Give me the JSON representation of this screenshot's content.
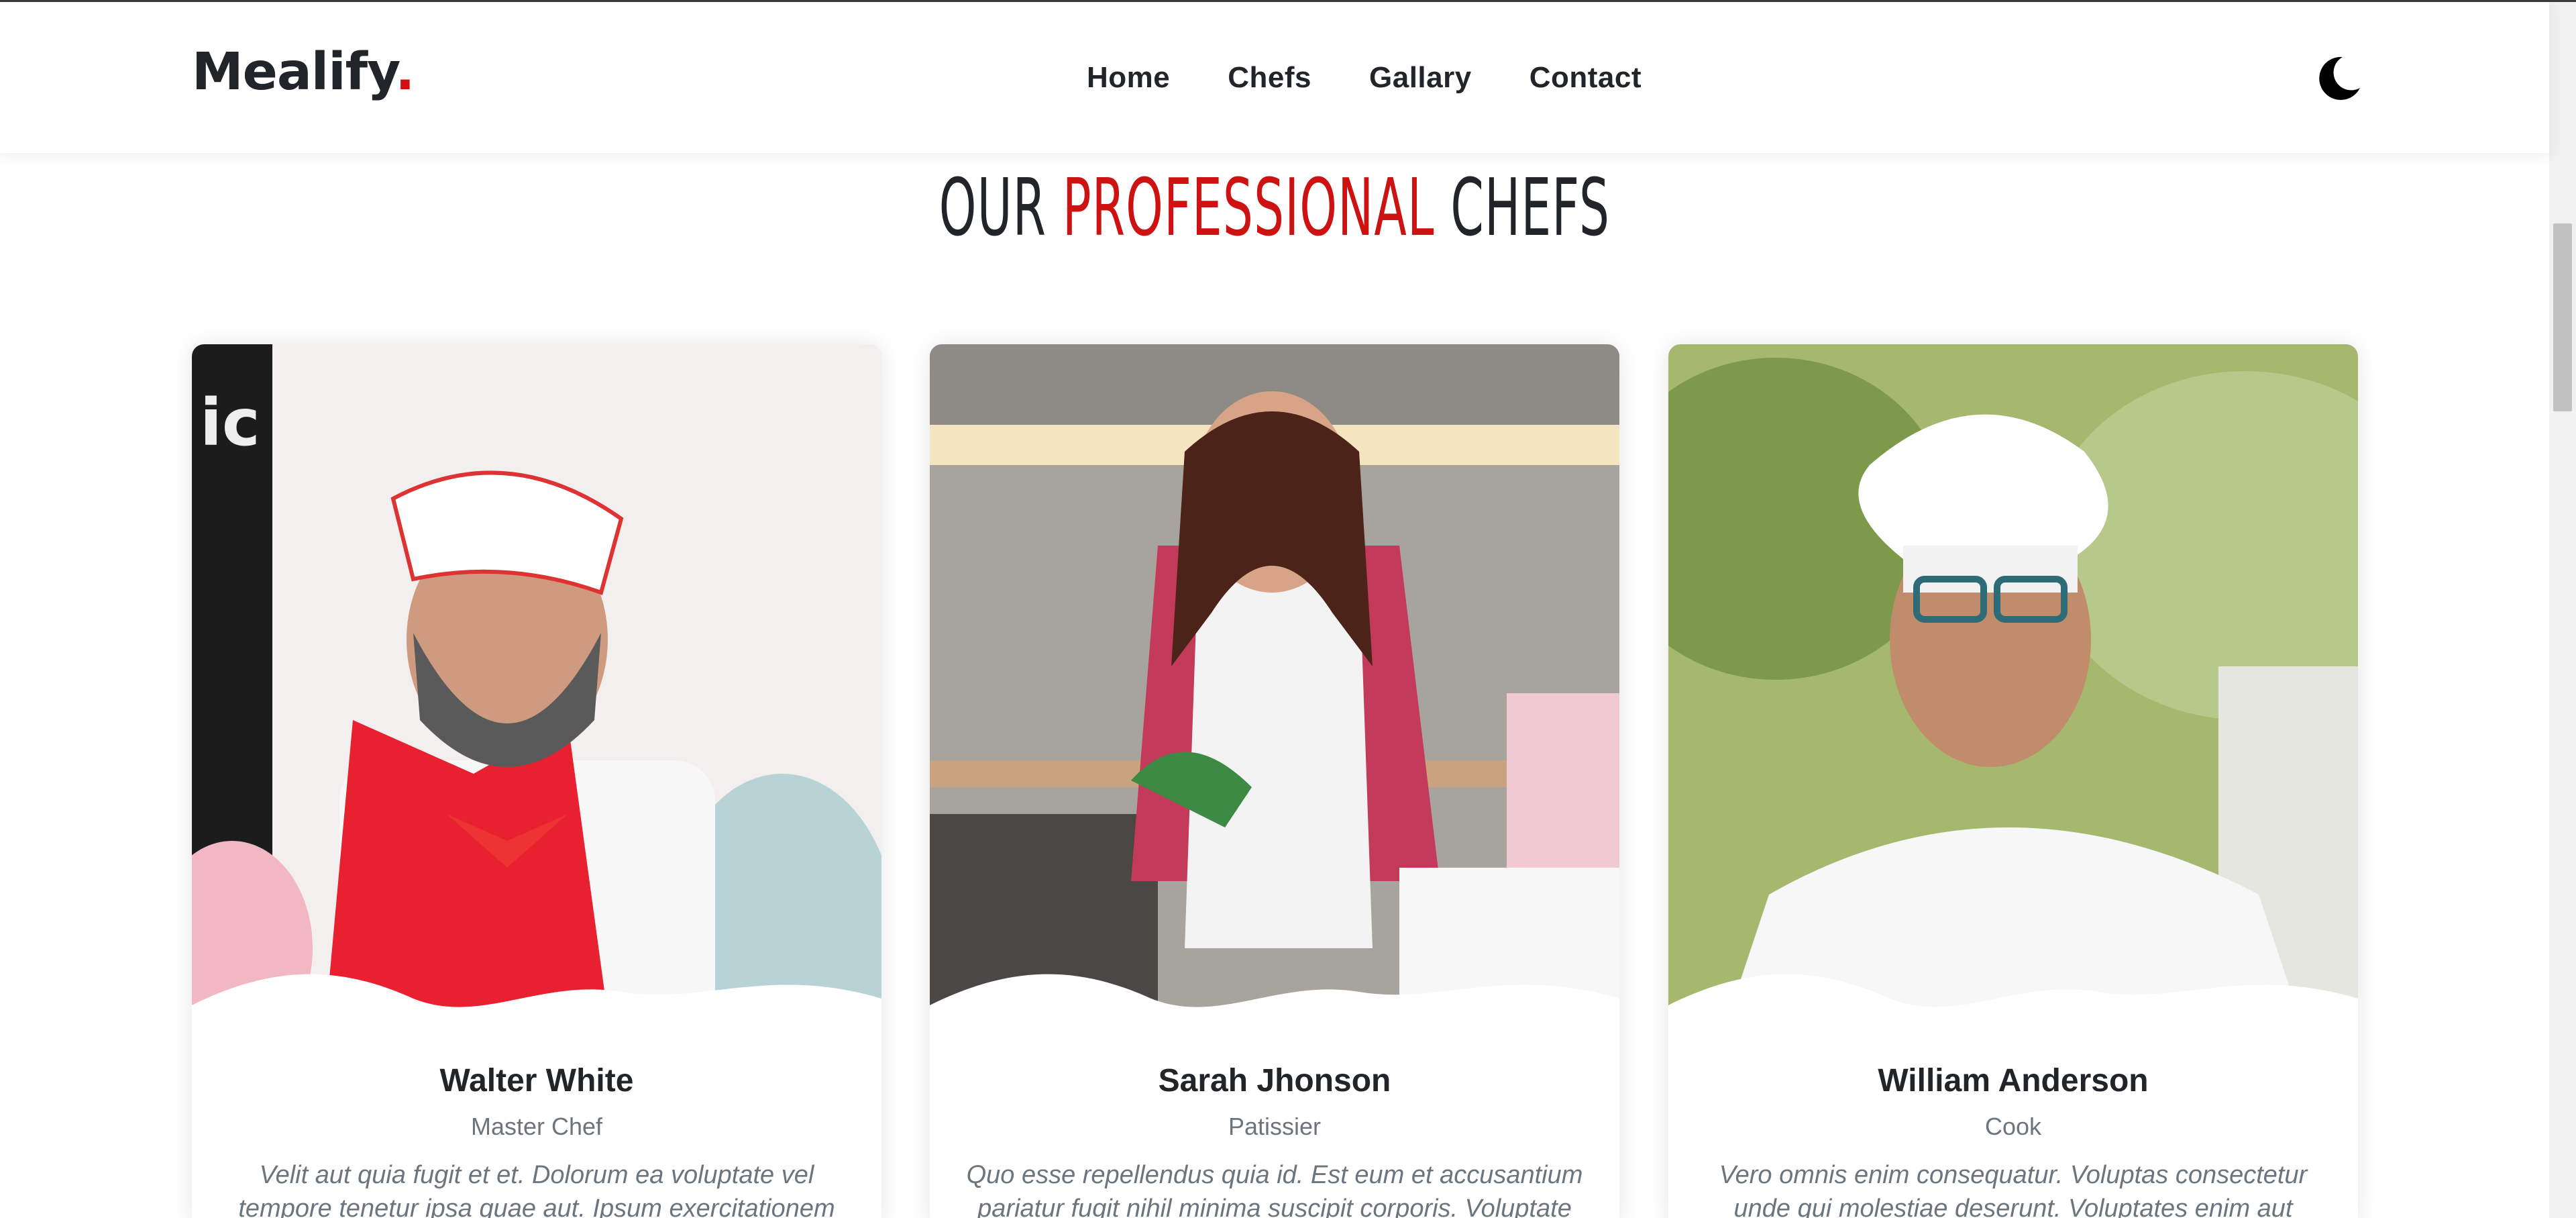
{
  "header": {
    "logo_text": "Mealify",
    "logo_dot": ".",
    "nav": [
      {
        "label": "Home"
      },
      {
        "label": "Chefs"
      },
      {
        "label": "Gallary"
      },
      {
        "label": "Contact"
      }
    ],
    "theme_toggle_icon": "moon-icon"
  },
  "section": {
    "title_part1": "OUR",
    "title_accent": "PROFESSIONAL",
    "title_part2": "CHEFS"
  },
  "chefs": [
    {
      "name": "Walter White",
      "role": "Master Chef",
      "bio": "Velit aut quia fugit et et. Dolorum ea voluptate vel tempore tenetur ipsa quae aut. Ipsum exercitationem"
    },
    {
      "name": "Sarah Jhonson",
      "role": "Patissier",
      "bio": "Quo esse repellendus quia id. Est eum et accusantium pariatur fugit nihil minima suscipit corporis. Voluptate"
    },
    {
      "name": "William Anderson",
      "role": "Cook",
      "bio": "Vero omnis enim consequatur. Voluptas consectetur unde qui molestiae deserunt. Voluptates enim aut"
    }
  ],
  "colors": {
    "accent": "#ce1212",
    "text": "#212529",
    "muted": "#6c757d"
  }
}
